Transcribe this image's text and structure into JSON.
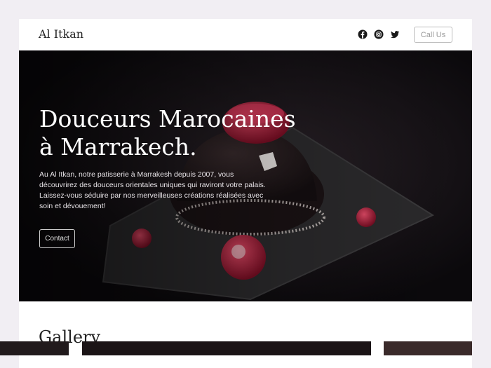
{
  "header": {
    "brand": "Al Itkan",
    "social": [
      "facebook-icon",
      "instagram-icon",
      "twitter-icon"
    ],
    "cta_label": "Call Us"
  },
  "hero": {
    "title_line1": "Douceurs Marocaines",
    "title_line2": "à Marrakech.",
    "text_lines": [
      "Au Al Itkan, notre patisserie à Marrakesh depuis 2007, vous",
      "découvrirez des douceurs orientales uniques qui raviront votre palais.",
      "Laissez-vous séduire par nos merveilleuses créations réalisées avec",
      "soin et dévouement!"
    ],
    "button_label": "Contact"
  },
  "gallery": {
    "title": "Gallery"
  },
  "colors": {
    "page_bg": "#f1eef3",
    "hero_bg": "#0c0a0e",
    "raspberry": "#c0284a"
  }
}
